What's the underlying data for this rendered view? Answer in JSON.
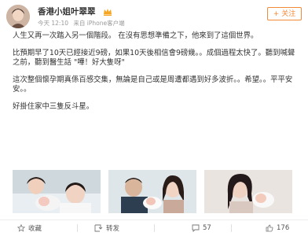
{
  "post": {
    "username": "香港小姐叶翠翠",
    "time": "今天 12:10",
    "source": "来自 iPhone客户端",
    "follow_label": "+ 关注",
    "paragraphs": [
      "人生又再一次踏入另一個階段。   在沒有思想準備之下，他來到了這個世界。",
      "比預期早了10天已經接近9磅，如果10天後相信會9磅幾。。成個過程太快了。聽到喊聲之前，聽到醫生話 \"嘩！好大隻呀\"",
      "這次整個懷孕期真係百感交集，無論是自己或是周遭都遇到好多波折。。希望。。平平安安。。",
      "好掛住家中三隻反斗星。"
    ]
  },
  "footer": {
    "collect": "收藏",
    "repost": "转发",
    "comments": "57",
    "likes": "176"
  },
  "colors": {
    "accent": "#f18b3a",
    "text": "#333333",
    "meta": "#999999"
  },
  "icons": [
    "crown-icon",
    "star-icon",
    "repost-icon",
    "comment-icon",
    "like-icon"
  ]
}
